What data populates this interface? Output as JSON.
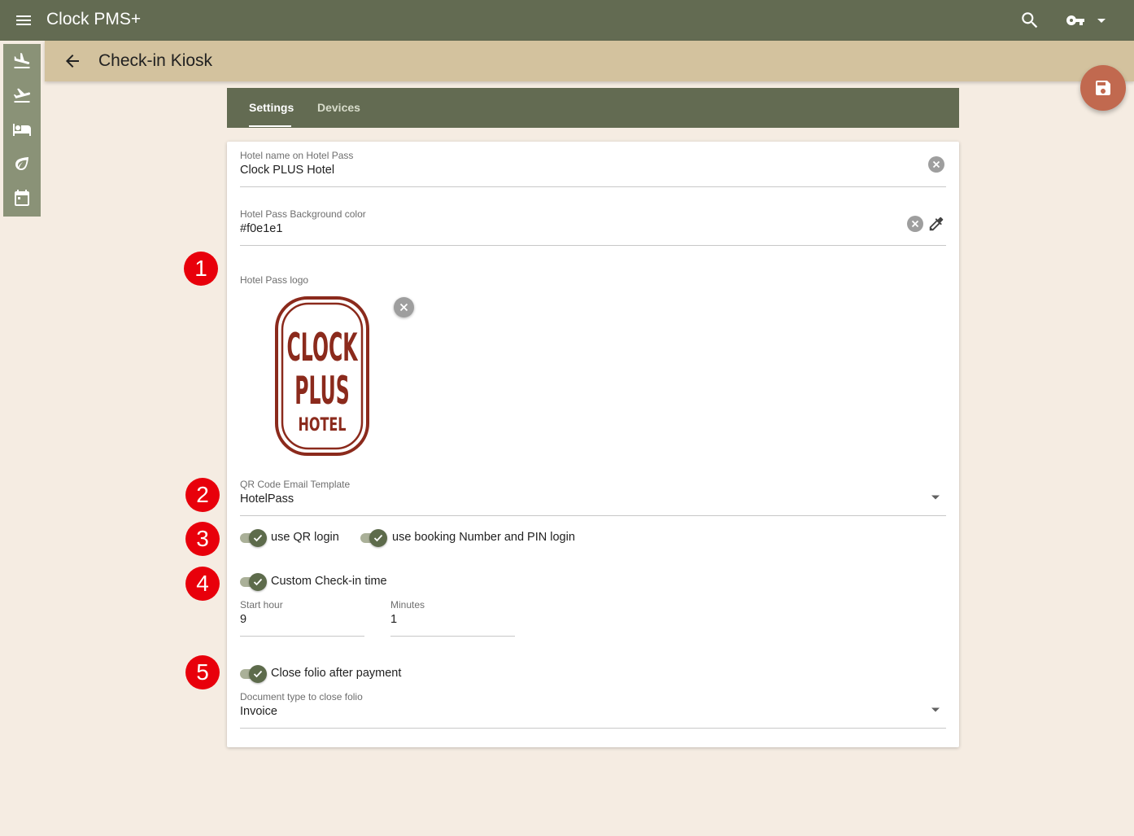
{
  "app": {
    "title": "Clock PMS+"
  },
  "page": {
    "title": "Check-in Kiosk"
  },
  "tabs": [
    {
      "label": "Settings",
      "active": true
    },
    {
      "label": "Devices",
      "active": false
    }
  ],
  "sidebar": {
    "items": [
      "arrivals-icon",
      "departures-icon",
      "bed-icon",
      "leaf-icon",
      "calendar-icon"
    ]
  },
  "form": {
    "hotel_name": {
      "label": "Hotel name on Hotel Pass",
      "value": "Clock PLUS Hotel"
    },
    "bg_color": {
      "label": "Hotel Pass Background color",
      "value": "#f0e1e1"
    },
    "logo": {
      "label": "Hotel Pass logo",
      "line1": "CLOCK",
      "line2": "PLUS",
      "line3": "HOTEL"
    },
    "qr_template": {
      "label": "QR Code Email Template",
      "value": "HotelPass"
    },
    "toggles": {
      "qr_login": {
        "label": "use QR login",
        "on": true
      },
      "pin_login": {
        "label": "use booking Number and PIN login",
        "on": true
      },
      "custom_checkin": {
        "label": "Custom Check-in time",
        "on": true
      },
      "close_folio": {
        "label": "Close folio after payment",
        "on": true
      }
    },
    "start_hour": {
      "label": "Start hour",
      "value": "9"
    },
    "minutes": {
      "label": "Minutes",
      "value": "1"
    },
    "doc_type": {
      "label": "Document type to close folio",
      "value": "Invoice"
    }
  },
  "badges": [
    "1",
    "2",
    "3",
    "4",
    "5"
  ],
  "colors": {
    "topbar": "#636b52",
    "subheader": "#d3c29e",
    "fab": "#c1694f",
    "badge": "#e8000b",
    "toggle": "#5d6b4b",
    "background": "#f5ece2"
  }
}
